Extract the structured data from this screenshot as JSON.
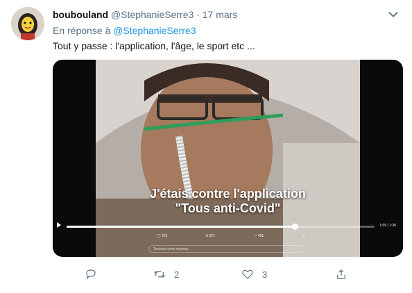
{
  "tweet": {
    "display_name": "boubouland",
    "handle": "@StephanieSerre3",
    "separator": "·",
    "date": "17 mars",
    "reply_prefix": "En réponse à",
    "reply_to": "@StephanieSerre3",
    "text": "Tout y passe : l'application, l'âge, le sport etc ...",
    "more_icon": "more-icon"
  },
  "media": {
    "caption_line1": "J'étais contre l'application",
    "caption_line2": "\"Tous anti-Covid\"",
    "time": "1:09 / 1:36",
    "progress": 0.74,
    "inner_stats": {
      "replies": "373",
      "retweets": "371",
      "likes": "491"
    },
    "inner_reply_placeholder": "Tweetez votre réponse."
  },
  "actions": {
    "reply_count": "",
    "retweet_count": "2",
    "like_count": "3",
    "share_count": ""
  },
  "colors": {
    "link": "#1b95e0",
    "muted": "#5b7083"
  }
}
